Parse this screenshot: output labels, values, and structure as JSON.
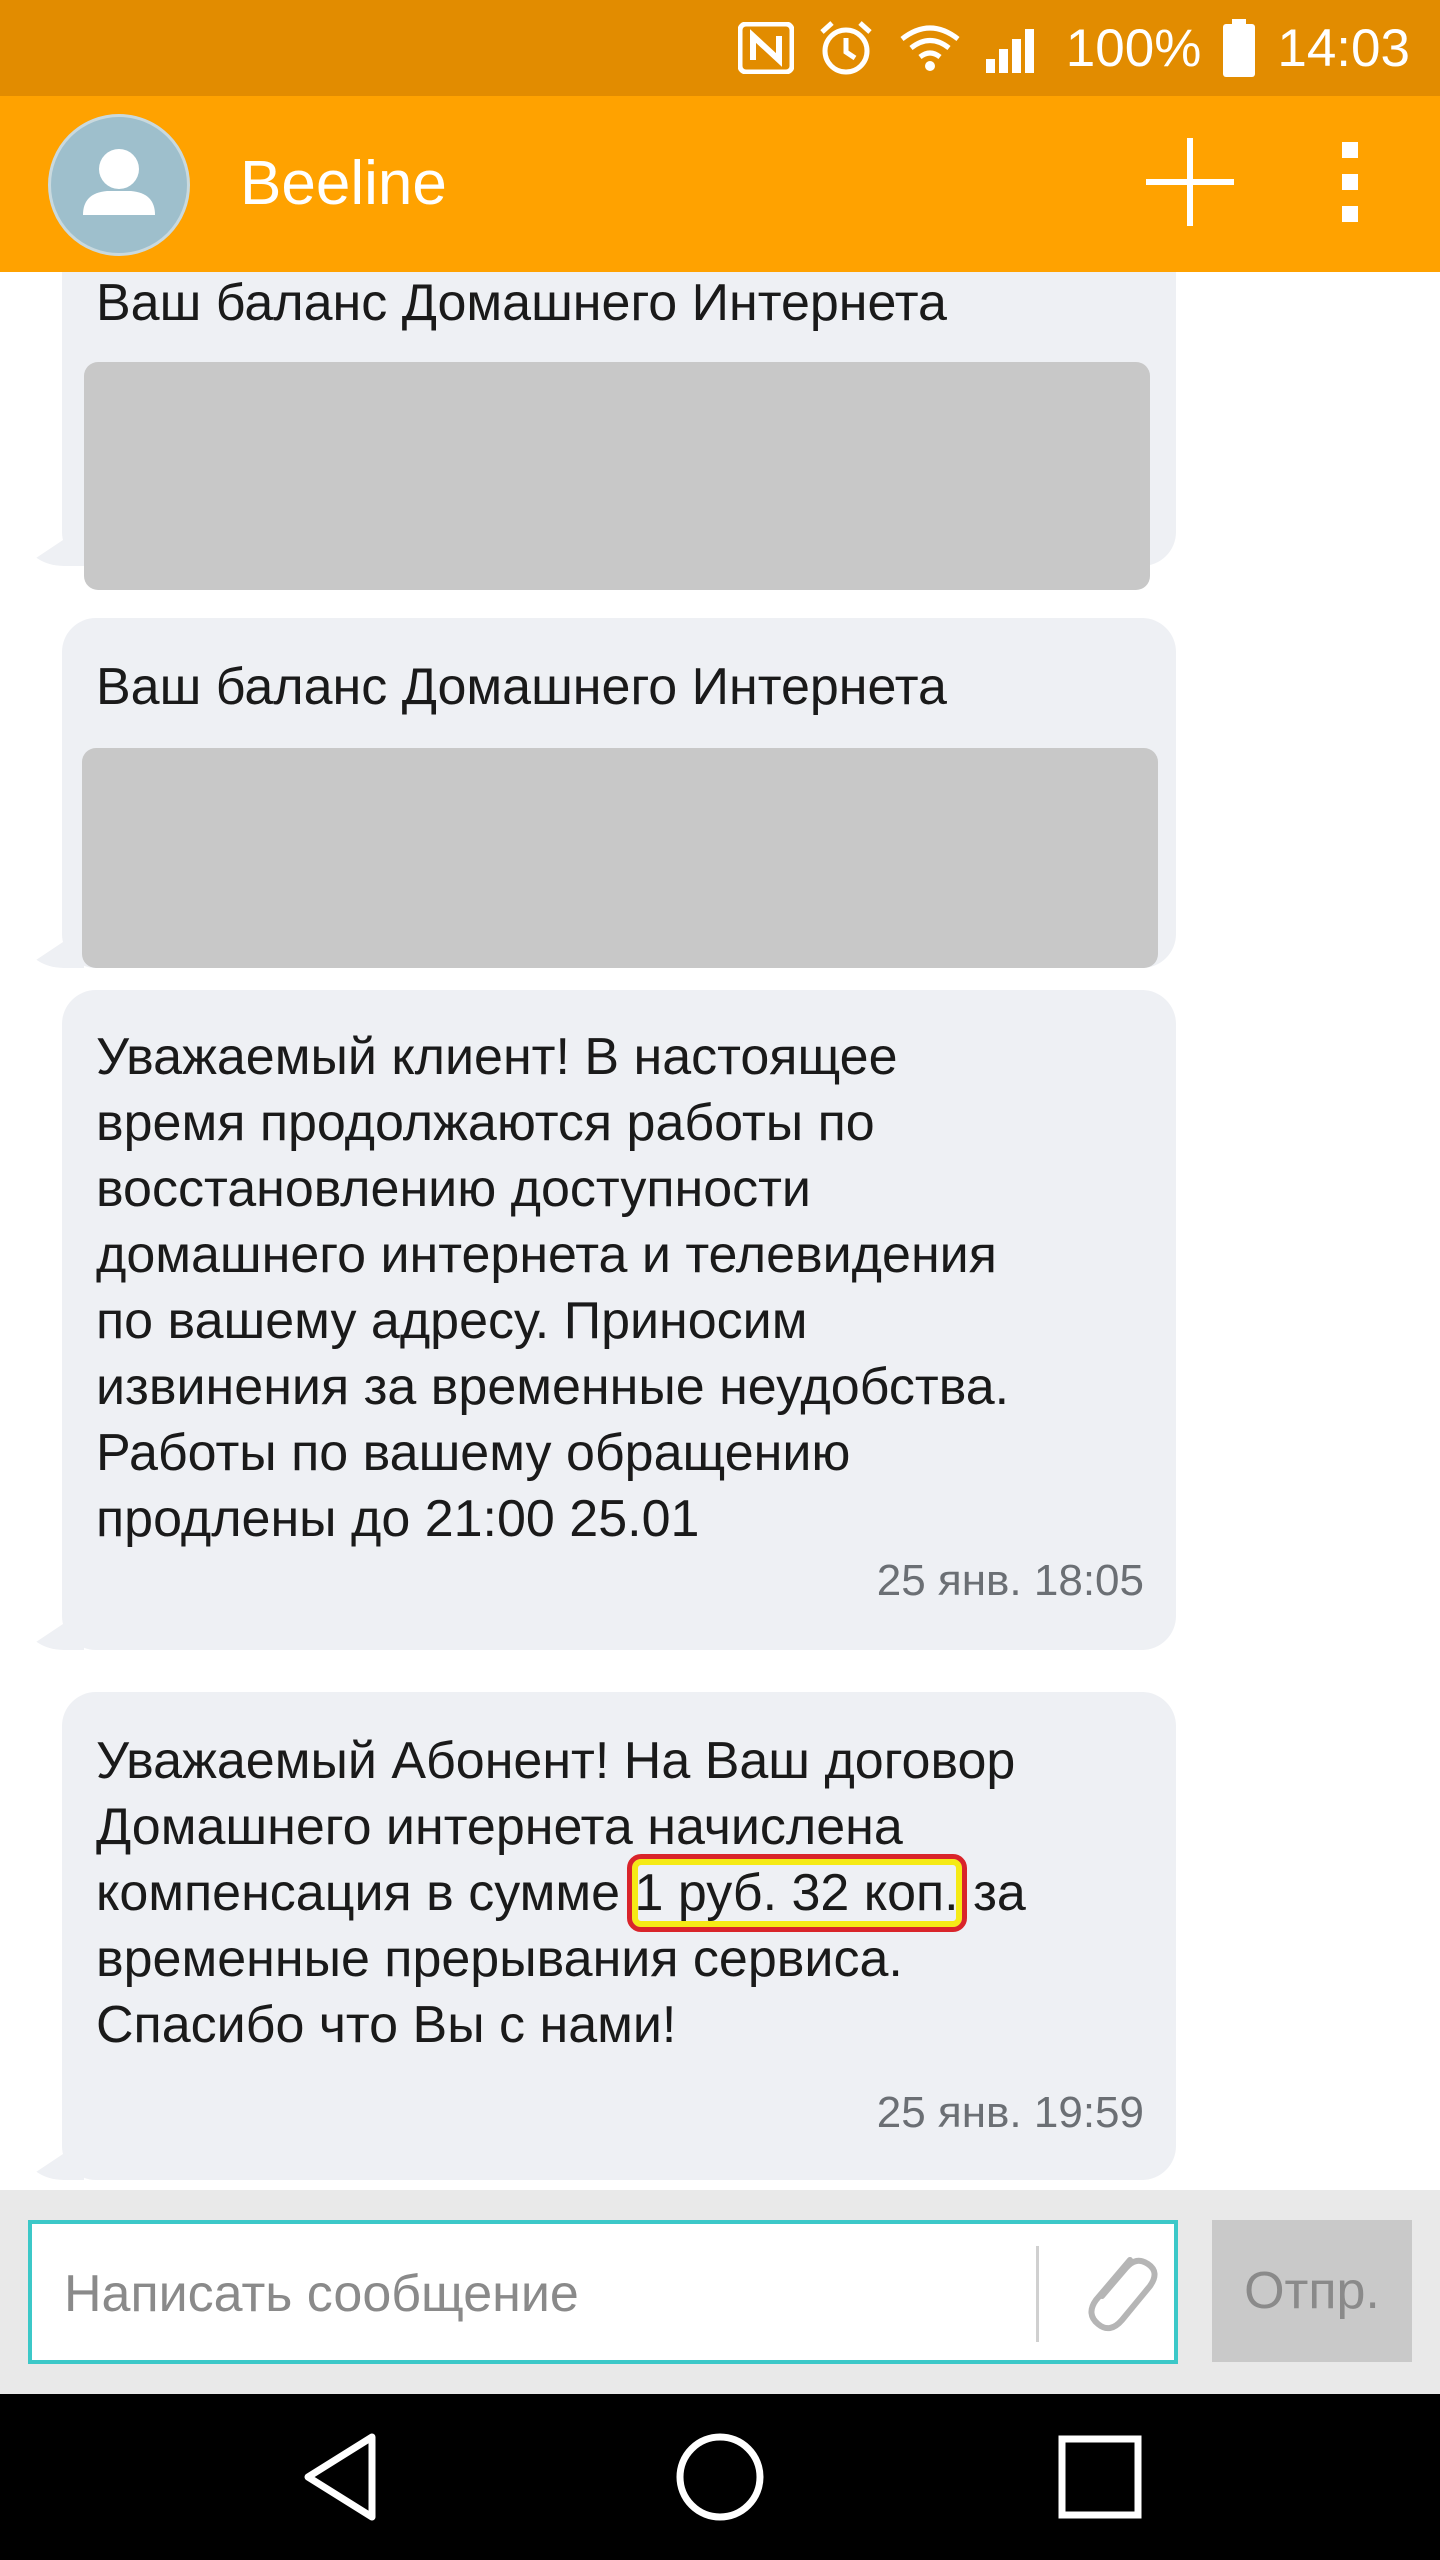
{
  "status_bar": {
    "battery": "100%",
    "time": "14:03",
    "icons": [
      "nfc-icon",
      "alarm-icon",
      "wifi-icon",
      "signal-icon",
      "battery-icon"
    ]
  },
  "app_bar": {
    "title": "Beeline",
    "icons": [
      "avatar-icon",
      "add-icon",
      "overflow-menu-icon"
    ]
  },
  "messages": [
    {
      "text": "Ваш баланс Домашнего Интернета",
      "redacted": true
    },
    {
      "text": "Ваш баланс Домашнего Интернета",
      "redacted": true
    },
    {
      "text": "Уважаемый клиент! В настоящее\nвремя продолжаются работы по\nвосстановлению доступности\nдомашнего интернета и телевидения\nпо вашему адресу. Приносим\nизвинения за временные неудобства.\nРаботы по вашему обращению\nпродлены до 21:00 25.01",
      "timestamp": "25 янв. 18:05"
    },
    {
      "text_line1": "Уважаемый Абонент! На Ваш договор",
      "text_line2": "Домашнего интернета начислена",
      "text_line3_before": "компенсация в сумме ",
      "text_highlight": "1 руб. 32 коп.",
      "text_line3_after": " за",
      "text_line4": "временные прерывания сервиса.",
      "text_line5": "Спасибо что Вы с нами!",
      "timestamp": "25 янв. 19:59"
    }
  ],
  "compose": {
    "placeholder": "Написать сообщение",
    "send_label": "Отпр.",
    "accent_color": "#3cc8c8"
  },
  "colors": {
    "status_bar": "#e28c00",
    "app_bar": "#ffa200",
    "bubble": "#eef0f4",
    "highlight_border": "#d9242a",
    "highlight_fill": "#f5ea16"
  },
  "nav_bar": {
    "icons": [
      "back-icon",
      "home-icon",
      "recents-icon"
    ]
  }
}
